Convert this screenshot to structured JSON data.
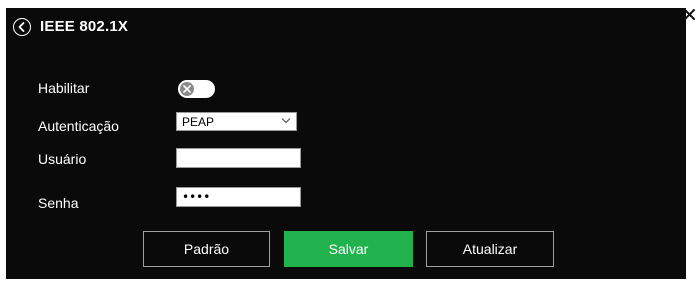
{
  "header": {
    "title": "IEEE 802.1X",
    "back_icon": "back-circle-chevron-icon",
    "close_icon": "close-icon"
  },
  "form": {
    "enable": {
      "label": "Habilitar",
      "enabled": false
    },
    "authentication": {
      "label": "Autenticação",
      "selected": "PEAP"
    },
    "username": {
      "label": "Usuário",
      "value": ""
    },
    "password": {
      "label": "Senha",
      "value": "••••"
    }
  },
  "buttons": {
    "default_label": "Padrão",
    "save_label": "Salvar",
    "refresh_label": "Atualizar"
  },
  "colors": {
    "panel_background": "#0a0a0a",
    "save_button": "#21b24d",
    "toggle_off_knob": "#8a8a8a"
  }
}
